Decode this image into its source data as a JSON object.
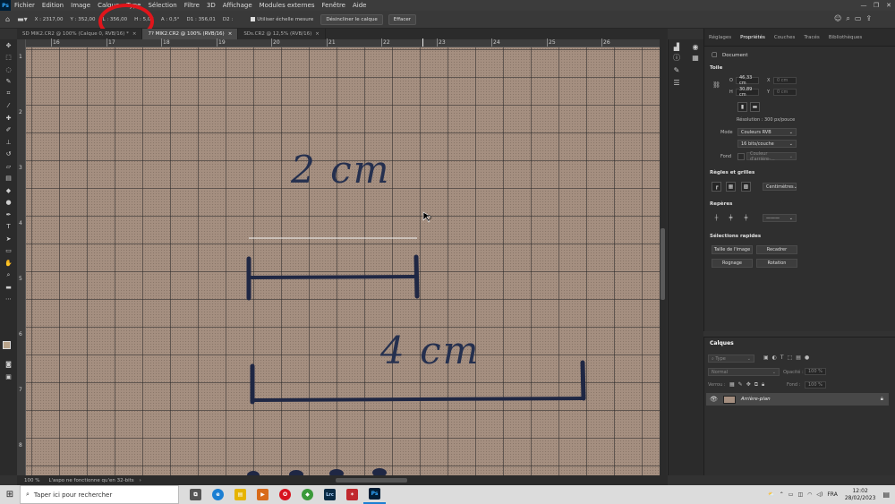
{
  "menu": {
    "logo": "Ps",
    "items": [
      "Fichier",
      "Edition",
      "Image",
      "Calque",
      "Type",
      "Sélection",
      "Filtre",
      "3D",
      "Affichage",
      "Modules externes",
      "Fenêtre",
      "Aide"
    ]
  },
  "window_controls": {
    "minimize": "—",
    "restore": "❐",
    "close": "✕"
  },
  "options_bar": {
    "x": "X : 2317,00",
    "y": "Y : 352,00",
    "l": "L : 356,00",
    "h": "H : 5,00",
    "a": "A : 0,5°",
    "d1": "D1 : 356,01",
    "d2": "D2 :",
    "scale_checkbox": "Utiliser échelle mesure",
    "straighten_btn": "Désincliner le calque",
    "clear_btn": "Effacer"
  },
  "tabs": [
    {
      "label": "SD MIK2.CR2 @ 100% (Calque 0, RVB/16) *",
      "close": "×"
    },
    {
      "label": "7? MIK2.CR2 @ 100% (RVB/16)",
      "close": "×"
    },
    {
      "label": "SDs.CR2 @ 12,5% (RVB/16)",
      "close": "×"
    }
  ],
  "ruler": {
    "top_labels": [
      "16",
      "17",
      "18",
      "19",
      "20",
      "21",
      "22",
      "23",
      "24",
      "25",
      "26"
    ],
    "left_labels": [
      "1",
      "2",
      "3",
      "4",
      "5",
      "6",
      "7",
      "8"
    ]
  },
  "canvas": {
    "label_2cm": "2 cm",
    "label_4cm": "4 cm"
  },
  "status": {
    "zoom": "100 %",
    "message": "L'aspo ne fonctionne qu'en 32-bits",
    "arrow": "›"
  },
  "properties": {
    "tabs": [
      "Réglages",
      "Propriétés",
      "Couches",
      "Tracés",
      "Bibliothèques"
    ],
    "doc_label": "Document",
    "canvas_title": "Toile",
    "w_label": "O",
    "w_value": "46,33 cm",
    "h_label": "H",
    "h_value": "30,89 cm",
    "x_label": "X",
    "x_value": "0 cm",
    "y_label": "Y",
    "y_value": "0 cm",
    "resolution": "Résolution : 300 px/pouce",
    "mode_label": "Mode",
    "mode_value": "Couleurs RVB",
    "depth_value": "16 bits/couche",
    "fill_label": "Fond",
    "fill_value": "Couleur d'arrière-...",
    "rulers_title": "Règles et grilles",
    "units_value": "Centimètres",
    "guides_title": "Repères",
    "quick_title": "Sélections rapides",
    "btn_image_size": "Taille de l'image",
    "btn_crop": "Recadrer",
    "btn_trim": "Rognage",
    "btn_rotate": "Rotation"
  },
  "layers": {
    "title": "Calques",
    "filter_placeholder": "Type",
    "blend_mode": "Normal",
    "opacity_label": "Opacité :",
    "opacity_value": "100 %",
    "lock_label": "Verrou :",
    "fill_label": "Fond :",
    "fill_value": "100 %",
    "layer_name": "Arrière-plan"
  },
  "taskbar": {
    "search_placeholder": "Taper ici pour rechercher",
    "lang": "FRA",
    "time": "12:02",
    "date": "28/02/2023",
    "apps": [
      {
        "name": "taskview",
        "glyph": "⧉",
        "color": "#555555"
      },
      {
        "name": "edge",
        "glyph": "e",
        "color": "#1b7fd3"
      },
      {
        "name": "explorer",
        "glyph": "▤",
        "color": "#e6b400"
      },
      {
        "name": "media",
        "glyph": "▶",
        "color": "#d86b1a"
      },
      {
        "name": "opera",
        "glyph": "O",
        "color": "#d7131e"
      },
      {
        "name": "app-green",
        "glyph": "◆",
        "color": "#3a9a3a"
      },
      {
        "name": "lightroom",
        "glyph": "Lrc",
        "color": "#0a2b45"
      },
      {
        "name": "app-red",
        "glyph": "✶",
        "color": "#c0282d"
      },
      {
        "name": "photoshop",
        "glyph": "Ps",
        "color": "#001e36"
      }
    ]
  },
  "colors": {
    "highlight_circle": "#e0151b",
    "ink": "#25304f"
  }
}
